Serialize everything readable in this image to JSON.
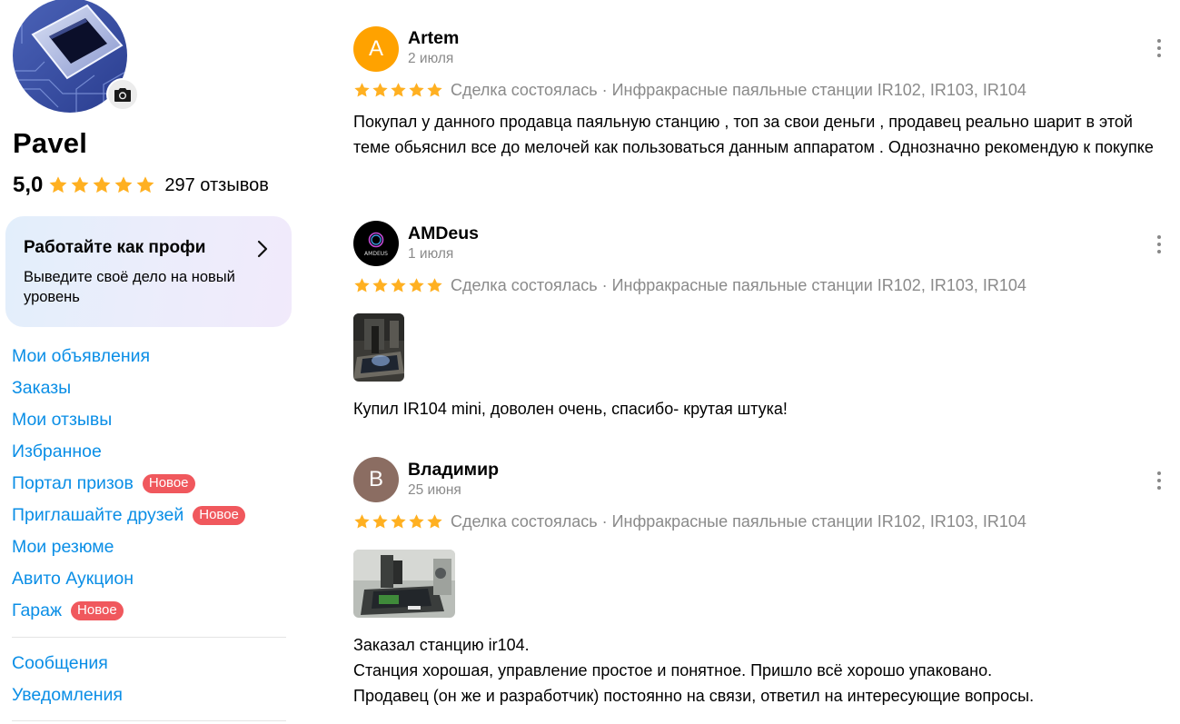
{
  "profile": {
    "name": "Pavel",
    "rating": "5,0",
    "reviews_count": "297 отзывов",
    "star_color": "#ffb021"
  },
  "promo": {
    "title": "Работайте как профи",
    "subtitle": "Выведите своё дело на новый уровень"
  },
  "nav": {
    "items": [
      {
        "label": "Мои объявления"
      },
      {
        "label": "Заказы"
      },
      {
        "label": "Мои отзывы"
      },
      {
        "label": "Избранное"
      },
      {
        "label": "Портал призов",
        "badge": "Новое"
      },
      {
        "label": "Приглашайте друзей",
        "badge": "Новое"
      },
      {
        "label": "Мои резюме"
      },
      {
        "label": "Авито Аукцион"
      },
      {
        "label": "Гараж",
        "badge": "Новое"
      }
    ],
    "secondary": [
      {
        "label": "Сообщения"
      },
      {
        "label": "Уведомления"
      }
    ],
    "link_color": "#0a8ee6",
    "badge_color": "#f0585d"
  },
  "reviews": [
    {
      "author": "Artem",
      "avatar_letter": "A",
      "avatar_color": "#ffa200",
      "date": "2 июля",
      "meta": "Сделка состоялась · Инфракрасные паяльные станции IR102, IR103, IR104",
      "rating": 5,
      "text": "Покупал у данного продавца паяльную станцию , топ за свои деньги , продавец реально шарит в этой теме обьяснил все до мелочей как пользоваться данным аппаратом . Однозначно рекомендую к покупке"
    },
    {
      "author": "AMDeus",
      "avatar_letter": "AMDEUS",
      "avatar_color": "#000000",
      "date": "1 июля",
      "meta": "Сделка состоялась · Инфракрасные паяльные станции IR102, IR103, IR104",
      "rating": 5,
      "text": "Купил IR104 mini, доволен очень, спасибо- крутая штука!"
    },
    {
      "author": "Владимир",
      "avatar_letter": "В",
      "avatar_color": "#8b6d62",
      "date": "25 июня",
      "meta": "Сделка состоялась · Инфракрасные паяльные станции IR102, IR103, IR104",
      "rating": 5,
      "text_lines": [
        "Заказал станцию ir104.",
        "Станция хорошая, управление простое и понятное. Пришло всё хорошо упаковано.",
        "Продавец (он же и разработчик) постоянно на связи, ответил на интересующие вопросы."
      ]
    }
  ],
  "icons": {
    "star": "star-icon",
    "camera": "camera-icon",
    "chevron": "chevron-right-icon",
    "more": "more-vertical-icon"
  }
}
